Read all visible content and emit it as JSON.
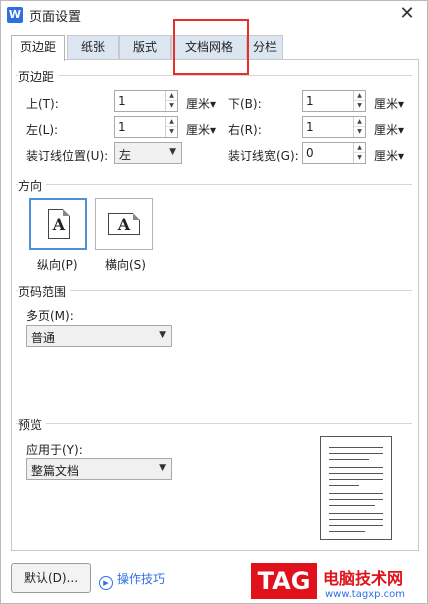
{
  "window": {
    "app_icon": "W",
    "title": "页面设置",
    "close": "✕"
  },
  "tabs": [
    {
      "label": "页边距",
      "active": true
    },
    {
      "label": "纸张",
      "active": false
    },
    {
      "label": "版式",
      "active": false
    },
    {
      "label": "文档网格",
      "active": false
    },
    {
      "label": "分栏",
      "active": false
    }
  ],
  "margins": {
    "group_label": "页边距",
    "top": {
      "label": "上(T):",
      "value": "1",
      "unit": "厘米▾"
    },
    "bottom": {
      "label": "下(B):",
      "value": "1",
      "unit": "厘米▾"
    },
    "left": {
      "label": "左(L):",
      "value": "1",
      "unit": "厘米▾"
    },
    "right": {
      "label": "右(R):",
      "value": "1",
      "unit": "厘米▾"
    },
    "gutter_pos": {
      "label": "装订线位置(U):",
      "value": "左"
    },
    "gutter_width": {
      "label": "装订线宽(G):",
      "value": "0",
      "unit": "厘米▾"
    }
  },
  "orientation": {
    "group_label": "方向",
    "portrait": {
      "label": "纵向(P)",
      "glyph": "A",
      "selected": true
    },
    "landscape": {
      "label": "横向(S)",
      "glyph": "A",
      "selected": false
    }
  },
  "page_range": {
    "group_label": "页码范围",
    "multi_label": "多页(M):",
    "multi_value": "普通"
  },
  "preview": {
    "group_label": "预览",
    "apply_label": "应用于(Y):",
    "apply_value": "整篇文档"
  },
  "footer": {
    "default_button": "默认(D)...",
    "tips_label": "操作技巧"
  },
  "watermark": {
    "logo": "TAG",
    "title": "电脑技术网",
    "url": "www.tagxp.com"
  },
  "colors": {
    "accent": "#2f6fe4",
    "highlight": "#e8302a",
    "tab_inactive": "#dce6f3"
  }
}
